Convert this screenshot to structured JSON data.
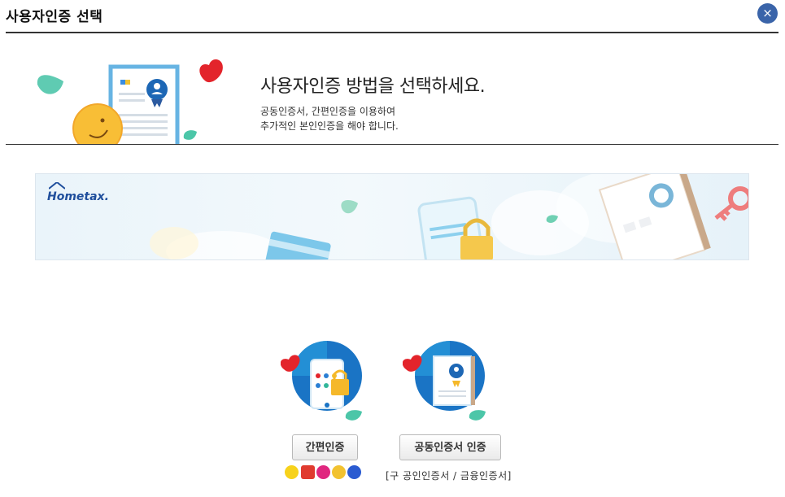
{
  "window": {
    "title": "사용자인증 선택",
    "close_label": "×"
  },
  "hero": {
    "heading": "사용자인증 방법을 선택하세요.",
    "description_line1": "공동인증서, 간편인증을 이용하여",
    "description_line2": "추가적인 본인인증을 해야 합니다."
  },
  "banner": {
    "logo_text": "Hometax."
  },
  "methods": {
    "simple_label": "간편인증",
    "cert_label": "공동인증서 인증",
    "cert_note": "[구 공인인증서 / 금융인증서]"
  },
  "providers": [
    "kakao-icon",
    "payco-icon",
    "pass-icon",
    "kb-icon",
    "samsung-pass-icon"
  ],
  "colors": {
    "accent": "#3a64a9",
    "icon_blue": "#1a74c5",
    "heart": "#e3242b",
    "leaf": "#3cc1a2"
  }
}
